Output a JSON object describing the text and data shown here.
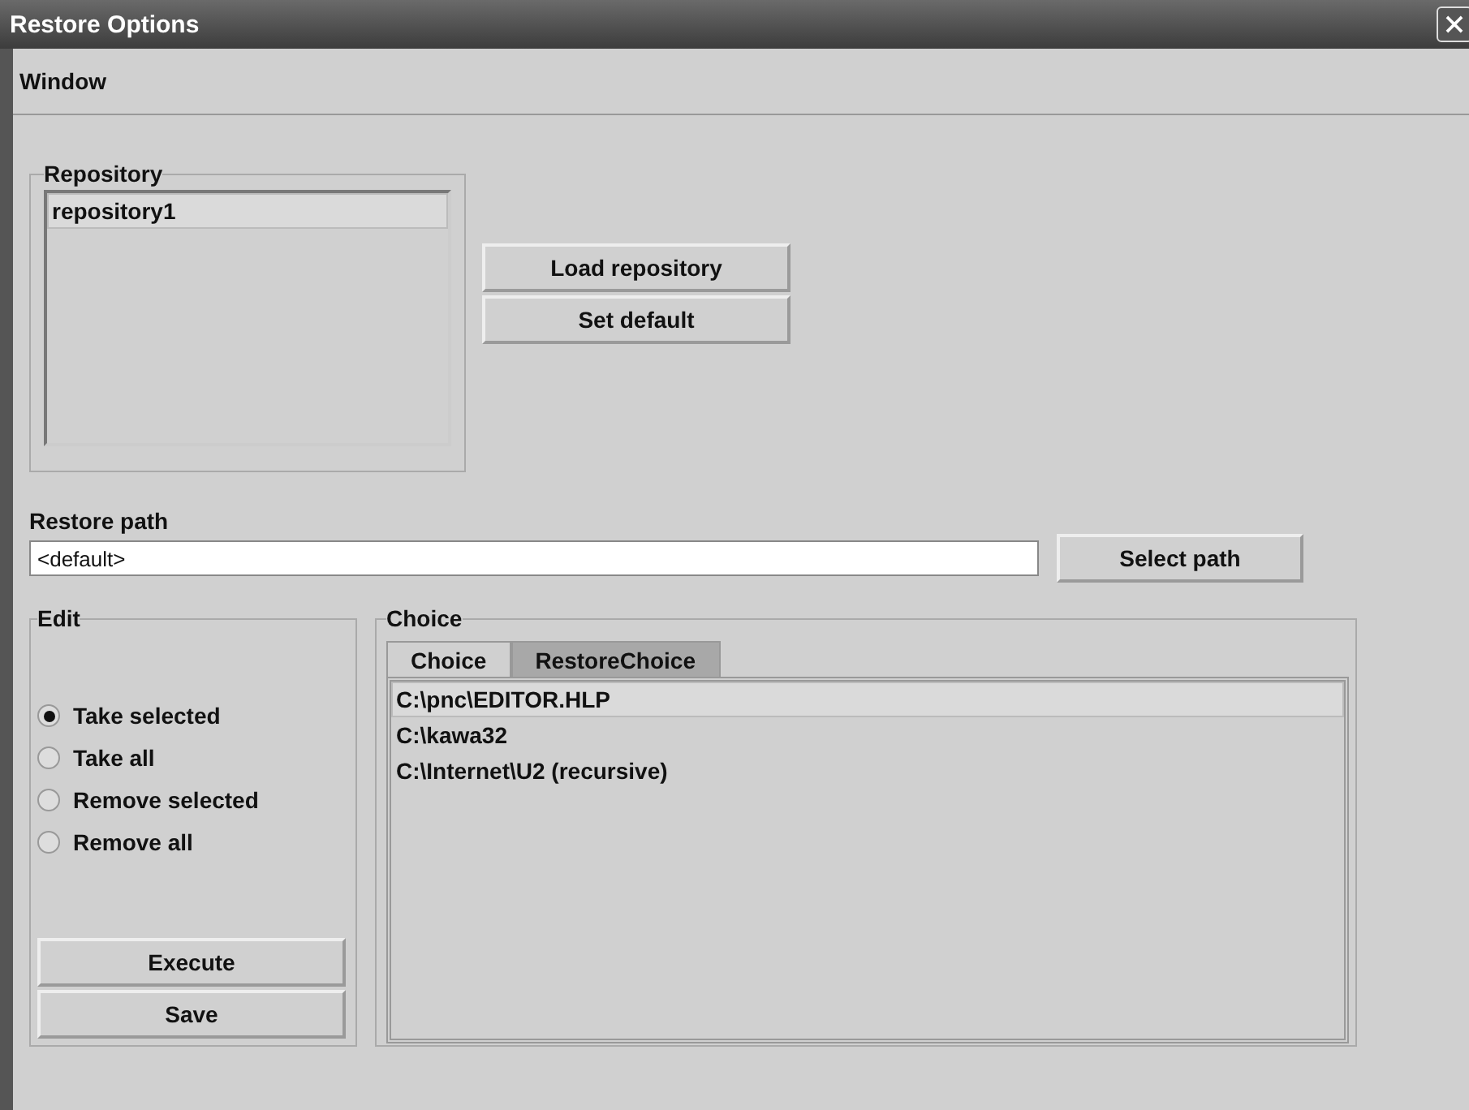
{
  "window": {
    "title": "Restore Options"
  },
  "menu": [
    {
      "label": "Window"
    }
  ],
  "repository": {
    "title": "Repository",
    "items": [
      {
        "label": "repository1",
        "selected": true
      }
    ],
    "buttons": [
      "Load repository",
      "Set default"
    ]
  },
  "restore_path": {
    "label": "Restore path",
    "value": "<default>",
    "button": "Select path"
  },
  "edit": {
    "title": "Edit",
    "options": [
      {
        "label": "Take selected",
        "selected": true
      },
      {
        "label": "Take all",
        "selected": false
      },
      {
        "label": "Remove selected",
        "selected": false
      },
      {
        "label": "Remove all",
        "selected": false
      }
    ],
    "buttons": [
      "Execute",
      "Save"
    ]
  },
  "choice": {
    "title": "Choice",
    "tabs": [
      {
        "label": "Choice",
        "selected": true
      },
      {
        "label": "RestoreChoice",
        "selected": false
      }
    ],
    "items": [
      {
        "label": "C:\\pnc\\EDITOR.HLP",
        "selected": true
      },
      {
        "label": "C:\\kawa32",
        "selected": false
      },
      {
        "label": "C:\\Internet\\U2 (recursive)",
        "selected": false
      }
    ]
  }
}
